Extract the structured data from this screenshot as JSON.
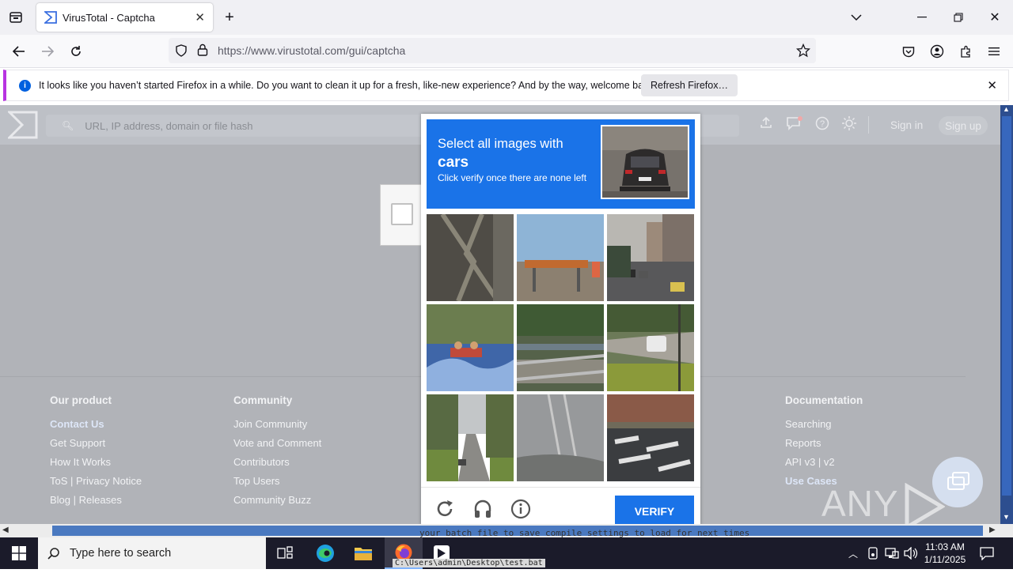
{
  "browser": {
    "tab_title": "VirusTotal - Captcha",
    "url": "https://www.virustotal.com/gui/captcha",
    "notification": {
      "message": "It looks like you haven’t started Firefox in a while. Do you want to clean it up for a fresh, like-new experience? And by the way, welcome back!",
      "button": "Refresh Firefox…"
    }
  },
  "vt": {
    "search_placeholder": "URL, IP address, domain or file hash",
    "sign_in": "Sign in",
    "sign_up": "Sign up"
  },
  "footer": {
    "col1": {
      "title": "Our product",
      "links": [
        "Contact Us",
        "Get Support",
        "How It Works",
        "ToS | Privacy Notice",
        "Blog | Releases"
      ]
    },
    "col2": {
      "title": "Community",
      "links": [
        "Join Community",
        "Vote and Comment",
        "Contributors",
        "Top Users",
        "Community Buzz"
      ]
    },
    "col6": {
      "title": "Documentation",
      "links": [
        "Searching",
        "Reports",
        "API v3 | v2",
        "Use Cases"
      ]
    }
  },
  "captcha": {
    "line1": "Select all images with",
    "target_word": "cars",
    "line3": "Click verify once there are none left",
    "verify_label": "VERIFY"
  },
  "taskbar": {
    "search_text": "Type here to search",
    "time": "11:03 AM",
    "date": "1/11/2025"
  },
  "background_console": "your batch file to save compile settings to load for next times",
  "background_path": "C:\\Users\\admin\\Desktop\\test.bat",
  "watermark": "ANY RUN",
  "colors": {
    "accent": "#1a73e8",
    "firefox_bar": "#f0f0f4",
    "overlay": "#b1b3b8",
    "taskbar": "#1b1b2a"
  }
}
